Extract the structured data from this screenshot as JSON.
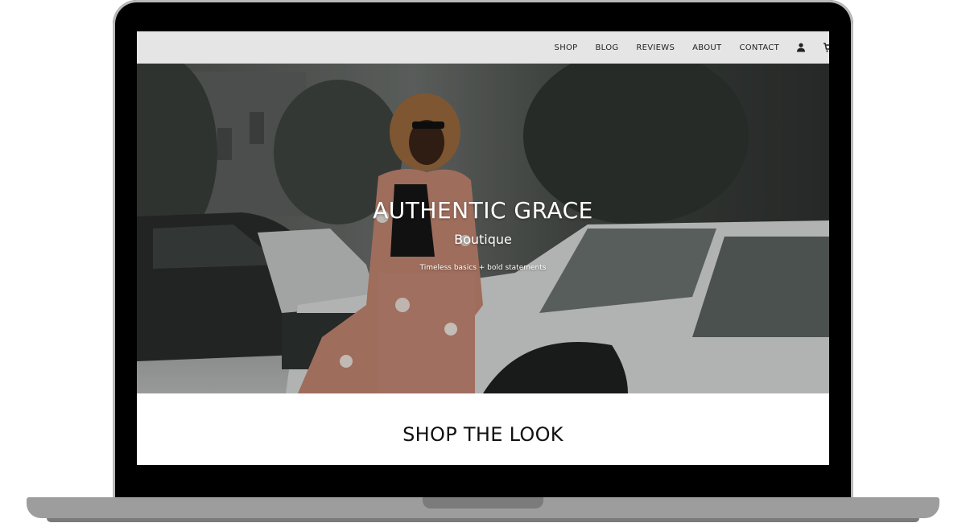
{
  "nav": {
    "items": [
      {
        "label": "SHOP"
      },
      {
        "label": "BLOG"
      },
      {
        "label": "REVIEWS"
      },
      {
        "label": "ABOUT"
      },
      {
        "label": "CONTACT"
      }
    ],
    "icons": [
      "account-icon",
      "cart-icon"
    ]
  },
  "hero": {
    "title": "AUTHENTIC GRACE",
    "subtitle": "Boutique",
    "tagline": "Timeless basics + bold statements"
  },
  "section": {
    "heading": "SHOP THE LOOK"
  },
  "colors": {
    "navbar_bg": "#e5e5e5",
    "device_frame": "#000000",
    "device_base": "#9d9d9d",
    "hero_text": "#ffffff"
  }
}
